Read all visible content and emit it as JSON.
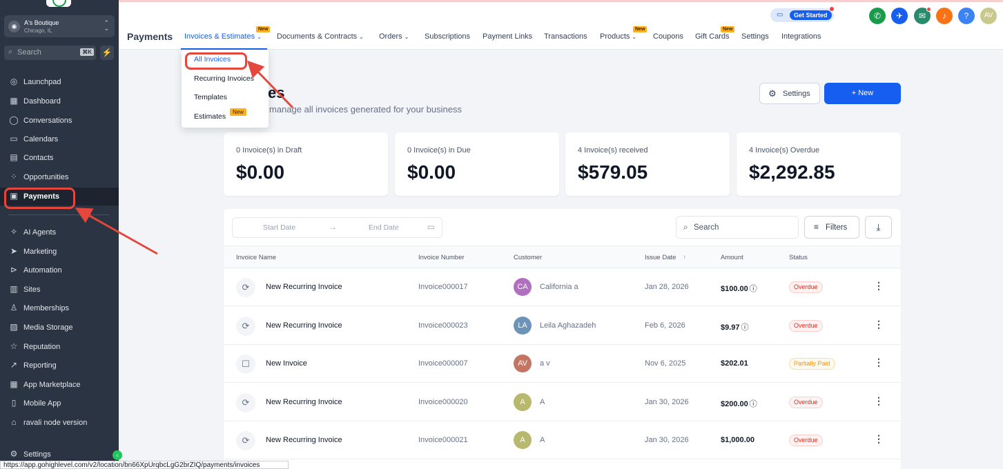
{
  "sidebar": {
    "account": {
      "name": "A's Boutique",
      "location": "Chicago, IL"
    },
    "search": {
      "placeholder": "Search",
      "shortcut": "⌘K"
    },
    "items": [
      {
        "label": "Launchpad",
        "icon": "launchpad-icon"
      },
      {
        "label": "Dashboard",
        "icon": "dashboard-icon"
      },
      {
        "label": "Conversations",
        "icon": "chat-icon"
      },
      {
        "label": "Calendars",
        "icon": "calendar-icon"
      },
      {
        "label": "Contacts",
        "icon": "contacts-icon"
      },
      {
        "label": "Opportunities",
        "icon": "opportunities-icon"
      },
      {
        "label": "Payments",
        "icon": "payments-icon",
        "active": true
      },
      {
        "label": "AI Agents",
        "icon": "sparkle-icon"
      },
      {
        "label": "Marketing",
        "icon": "send-icon"
      },
      {
        "label": "Automation",
        "icon": "automation-icon"
      },
      {
        "label": "Sites",
        "icon": "sites-icon"
      },
      {
        "label": "Memberships",
        "icon": "memberships-icon"
      },
      {
        "label": "Media Storage",
        "icon": "image-icon"
      },
      {
        "label": "Reputation",
        "icon": "star-icon"
      },
      {
        "label": "Reporting",
        "icon": "trend-icon"
      },
      {
        "label": "App Marketplace",
        "icon": "grid-icon"
      },
      {
        "label": "Mobile App",
        "icon": "phone-icon"
      },
      {
        "label": "ravali node version",
        "icon": "bank-icon"
      },
      {
        "label": "Settings",
        "icon": "gear-icon"
      }
    ]
  },
  "topbar": {
    "get_started": "Get Started",
    "user_initials": "AV",
    "help": "?"
  },
  "page_title": "Payments",
  "tabs": [
    {
      "label": "Invoices & Estimates",
      "dropdown": true,
      "new": true,
      "active": true
    },
    {
      "label": "Documents & Contracts",
      "dropdown": true
    },
    {
      "label": "Orders",
      "dropdown": true
    },
    {
      "label": "Subscriptions"
    },
    {
      "label": "Payment Links"
    },
    {
      "label": "Transactions"
    },
    {
      "label": "Products",
      "dropdown": true,
      "new": true
    },
    {
      "label": "Coupons"
    },
    {
      "label": "Gift Cards",
      "new": true
    },
    {
      "label": "Settings"
    },
    {
      "label": "Integrations"
    }
  ],
  "new_badge": "New",
  "dropdown_menu": [
    {
      "label": "All Invoices",
      "active": true
    },
    {
      "label": "Recurring Invoices"
    },
    {
      "label": "Templates"
    },
    {
      "label": "Estimates",
      "badge": "New"
    }
  ],
  "main": {
    "heading": "es",
    "subheading": "manage all invoices generated for your business",
    "settings_button": "Settings",
    "new_button": "New"
  },
  "cards": [
    {
      "label": "0 Invoice(s) in Draft",
      "value": "$0.00"
    },
    {
      "label": "0 Invoice(s) in Due",
      "value": "$0.00"
    },
    {
      "label": "4 Invoice(s) received",
      "value": "$579.05"
    },
    {
      "label": "4 Invoice(s) Overdue",
      "value": "$2,292.85"
    }
  ],
  "table": {
    "start_date": "Start Date",
    "end_date": "End Date",
    "search_placeholder": "Search",
    "filters": "Filters",
    "columns": [
      "Invoice Name",
      "Invoice Number",
      "Customer",
      "Issue Date",
      "Amount",
      "Status"
    ],
    "rows": [
      {
        "name": "New Recurring Invoice",
        "number": "Invoice000017",
        "initials": "CA",
        "avatar_color": "#b16fbf",
        "customer": "California a",
        "date": "Jan 28, 2026",
        "amount": "$100.00",
        "info": true,
        "status": "Overdue",
        "status_type": "overdue",
        "type": "recurring"
      },
      {
        "name": "New Recurring Invoice",
        "number": "Invoice000023",
        "initials": "LA",
        "avatar_color": "#6d94b8",
        "customer": "Leila Aghazadeh",
        "date": "Feb 6, 2026",
        "amount": "$9.97",
        "info": true,
        "status": "Overdue",
        "status_type": "overdue",
        "type": "recurring"
      },
      {
        "name": "New Invoice",
        "number": "Invoice000007",
        "initials": "AV",
        "avatar_color": "#c27563",
        "customer": "a v",
        "date": "Nov 6, 2025",
        "amount": "$202.01",
        "info": false,
        "status": "Partially Paid",
        "status_type": "partial",
        "type": "single"
      },
      {
        "name": "New Recurring Invoice",
        "number": "Invoice000020",
        "initials": "A",
        "avatar_color": "#b8b86e",
        "customer": "A",
        "date": "Jan 30, 2026",
        "amount": "$200.00",
        "info": true,
        "status": "Overdue",
        "status_type": "overdue",
        "type": "recurring"
      },
      {
        "name": "New Recurring Invoice",
        "number": "Invoice000021",
        "initials": "A",
        "avatar_color": "#b8b86e",
        "customer": "A",
        "date": "Jan 30, 2026",
        "amount": "$1,000.00",
        "info": false,
        "status": "Overdue",
        "status_type": "overdue",
        "type": "recurring"
      }
    ]
  },
  "status_url": "https://app.gohighlevel.com/v2/location/bn66XpUrqbcLgG2brZIQ/payments/invoices"
}
